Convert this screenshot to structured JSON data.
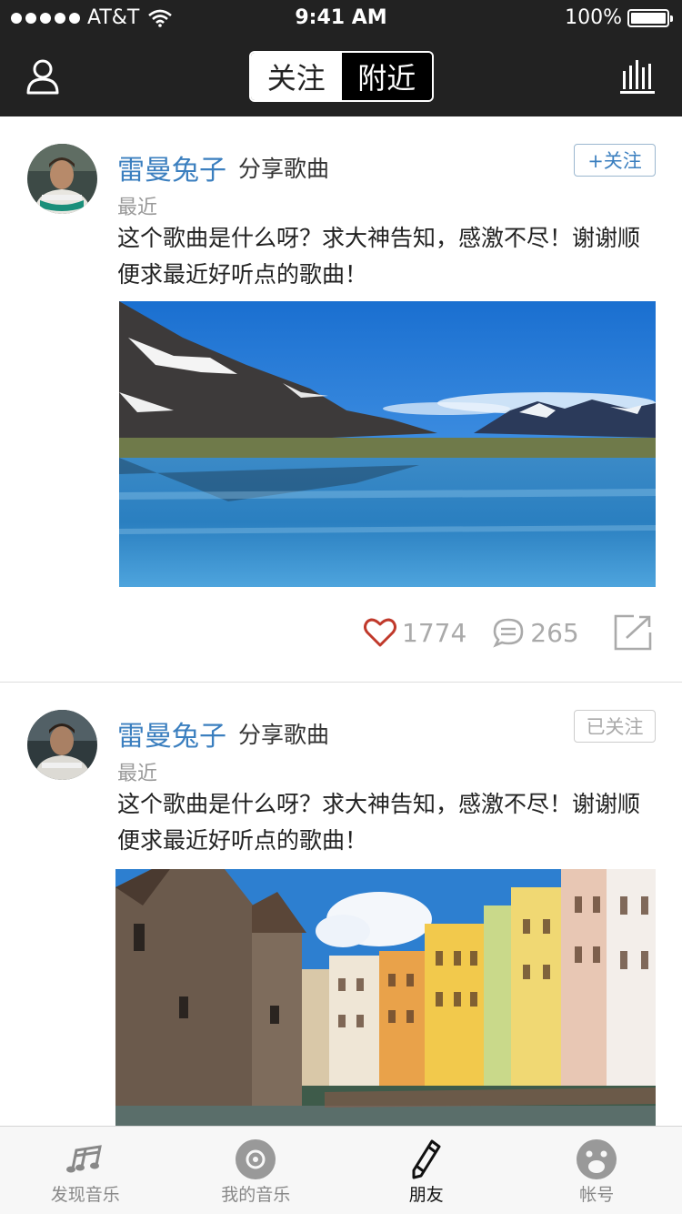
{
  "status_bar": {
    "carrier": "AT&T",
    "time": "9:41 AM",
    "battery": "100%",
    "signal_icon": "signal-dots-icon",
    "wifi_icon": "wifi-icon",
    "battery_icon": "battery-icon"
  },
  "nav": {
    "left_icon": "user-icon",
    "right_icon": "equalizer-icon",
    "segments": [
      {
        "label": "关注",
        "selected": false
      },
      {
        "label": "附近",
        "selected": true
      }
    ]
  },
  "posts": [
    {
      "username": "雷曼兔子",
      "action": "分享歌曲",
      "time": "最近",
      "text": "这个歌曲是什么呀？求大神告知，感激不尽！谢谢顺便求最近好听点的歌曲！",
      "follow_label": "+关注",
      "image": "mountain-lake-photo",
      "likes": "1774",
      "comments": "265"
    },
    {
      "username": "雷曼兔子",
      "action": "分享歌曲",
      "time": "最近",
      "text": "这个歌曲是什么呀？求大神告知，感激不尽！谢谢顺便求最近好听点的歌曲！",
      "follow_label": "已关注",
      "image": "canal-town-photo"
    }
  ],
  "tabbar": {
    "tabs": [
      {
        "label": "发现音乐",
        "icon": "music-note-icon"
      },
      {
        "label": "我的音乐",
        "icon": "disc-icon"
      },
      {
        "label": "朋友",
        "icon": "pencil-icon",
        "active": true
      },
      {
        "label": "帐号",
        "icon": "face-icon"
      }
    ]
  },
  "colors": {
    "header_bg": "#222222",
    "link_blue": "#3b7fbf",
    "like_red": "#c0392b",
    "muted": "#aaaaaa"
  }
}
